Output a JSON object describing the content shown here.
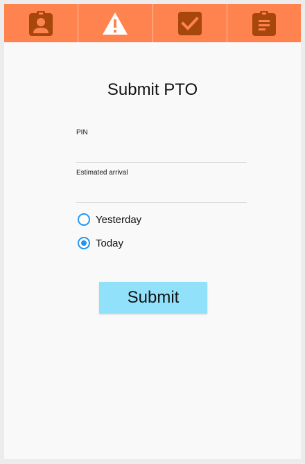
{
  "tabs": [
    {
      "icon": "id-badge-icon"
    },
    {
      "icon": "warning-icon"
    },
    {
      "icon": "checkbox-icon"
    },
    {
      "icon": "clipboard-list-icon"
    }
  ],
  "colors": {
    "tabbar": "#ff834f",
    "tab_icon": "#a8470b",
    "accent": "#2196f3",
    "submit": "#91e1fb"
  },
  "form": {
    "title": "Submit PTO",
    "pin": {
      "label": "PIN",
      "value": ""
    },
    "arrival": {
      "label": "Estimated arrival",
      "value": ""
    },
    "options": [
      {
        "label": "Yesterday",
        "checked": false
      },
      {
        "label": "Today",
        "checked": true
      }
    ],
    "submit_label": "Submit"
  }
}
